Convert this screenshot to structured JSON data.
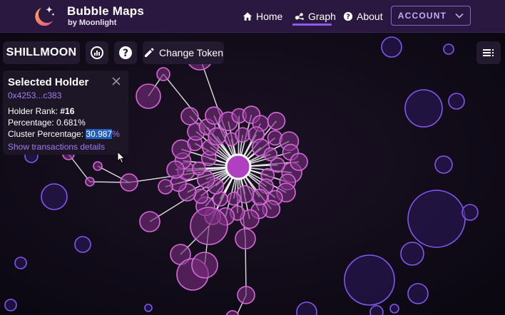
{
  "brand": {
    "title": "Bubble Maps",
    "subtitle": "by Moonlight"
  },
  "nav": {
    "home": "Home",
    "graph": "Graph",
    "about": "About",
    "active": "graph",
    "account": "ACCOUNT"
  },
  "toolbar": {
    "token": "SHILLMOON",
    "change_token": "Change Token"
  },
  "holder": {
    "title": "Selected Holder",
    "address": "0x4253...c383",
    "rank_label": "Holder Rank:",
    "rank_value": "#16",
    "percentage_label": "Percentage:",
    "percentage_value": "0.681%",
    "cluster_label": "Cluster Percentage:",
    "cluster_value": "30.987",
    "cluster_unit": "%",
    "details_link": "Show transactions details"
  },
  "colors": {
    "nav_bg": "#2a1840",
    "accent": "#8a5cf0",
    "link": "#a37af0",
    "bubble_pink_stroke": "#d66ad9",
    "bubble_pink_fill": "#7a2d7f",
    "bubble_purple_stroke": "#8456f0",
    "bubble_purple_fill": "#2c1a5e",
    "selection_highlight": "#1f5fbf"
  },
  "icons": {
    "logo": "moon-stars-logo",
    "home": "home-icon",
    "graph": "graph-icon",
    "about": "help-circle-icon",
    "account": "chevron-down-icon",
    "stats": "chart-icon",
    "help": "help-circle-icon",
    "edit": "pencil-icon",
    "menu": "list-menu-icon",
    "close": "close-icon"
  }
}
